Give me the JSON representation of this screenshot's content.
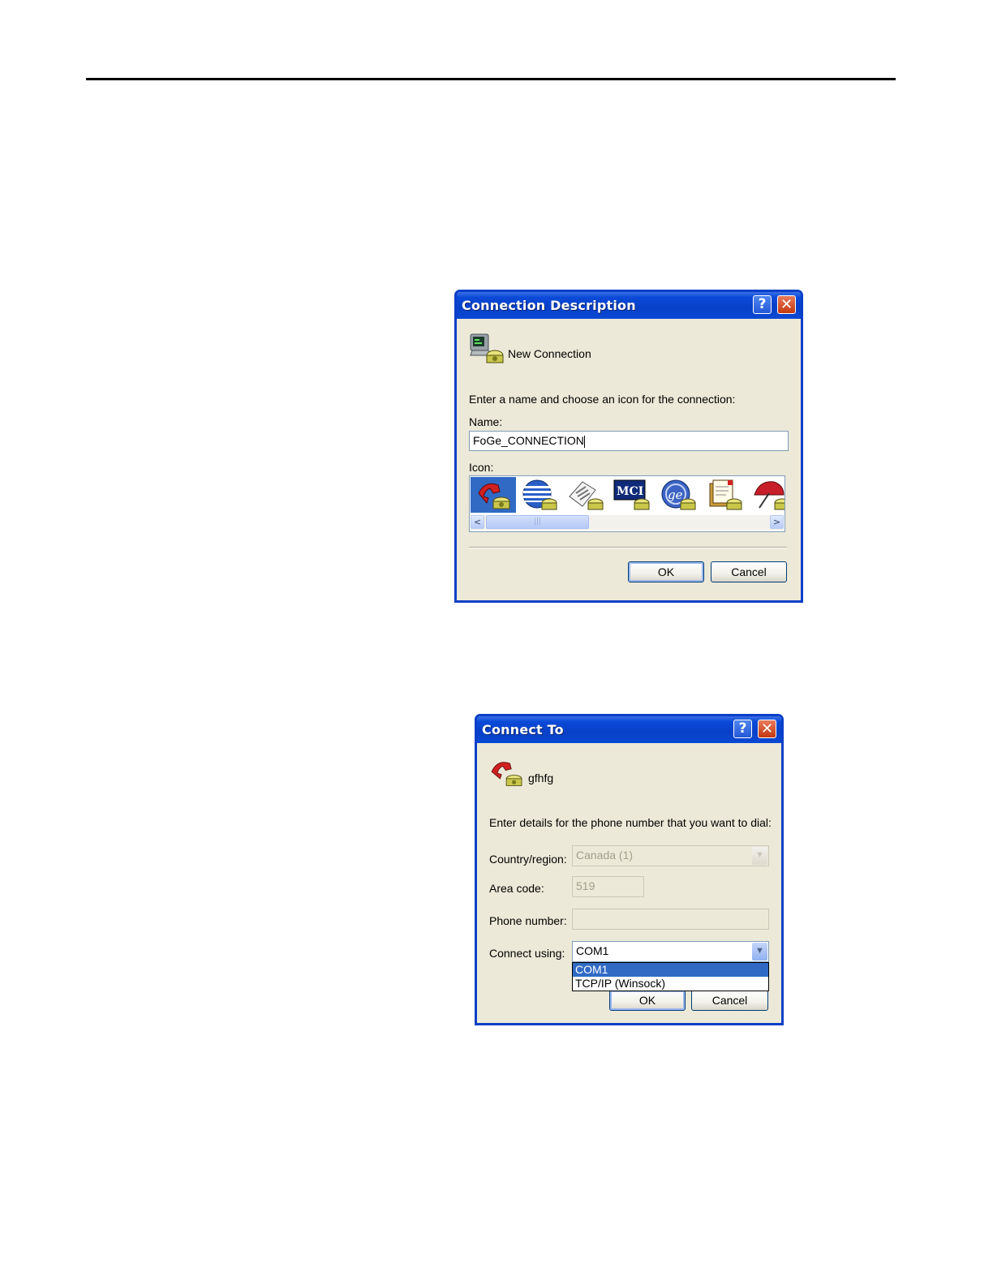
{
  "connection_description": {
    "title": "Connection Description",
    "help_glyph": "?",
    "close_glyph": "✕",
    "header_icon": "phone-computer-icon",
    "connection_label": "New Connection",
    "instruction": "Enter a name and choose an icon for the connection:",
    "name_label": "Name:",
    "name_value": "FoGe_CONNECTION",
    "icon_label": "Icon:",
    "icons": [
      "red-phone-icon",
      "globe-icon",
      "newspaper-phone-icon",
      "mci-phone-icon",
      "ge-phone-icon",
      "documents-phone-icon",
      "umbrella-phone-icon"
    ],
    "selected_icon": "red-phone-icon",
    "scroll_left": "<",
    "scroll_right": ">",
    "scroll_grip": "|||",
    "ok_label": "OK",
    "cancel_label": "Cancel"
  },
  "connect_to": {
    "title": "Connect To",
    "help_glyph": "?",
    "close_glyph": "✕",
    "header_icon": "red-phone-icon",
    "connection_name": "gfhfg",
    "instruction": "Enter details for the phone number that you want to dial:",
    "country_label": "Country/region:",
    "country_value": "Canada (1)",
    "area_label": "Area code:",
    "area_value": "519",
    "phone_label": "Phone number:",
    "phone_value": "",
    "connect_label": "Connect using:",
    "connect_value": "COM1",
    "dropdown_arrow": "▼",
    "connect_options": [
      "COM1",
      "TCP/IP (Winsock)"
    ],
    "selected_option": "COM1",
    "ok_label": "OK",
    "cancel_label": "Cancel"
  },
  "colors": {
    "xp_title_blue": "#0a4ad8",
    "dialog_face": "#ece9d8",
    "selection_blue": "#316ac5"
  }
}
